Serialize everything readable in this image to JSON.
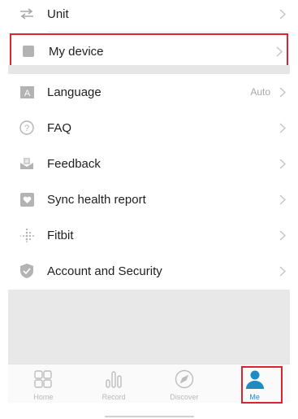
{
  "settings": {
    "unit": {
      "label": "Unit",
      "icon": "swap-arrows-icon"
    },
    "my_device": {
      "label": "My device",
      "icon": "device-icon"
    },
    "language": {
      "label": "Language",
      "value": "Auto",
      "icon": "language-icon"
    },
    "faq": {
      "label": "FAQ",
      "icon": "question-icon"
    },
    "feedback": {
      "label": "Feedback",
      "icon": "feedback-icon"
    },
    "sync": {
      "label": "Sync health report",
      "icon": "heart-icon"
    },
    "fitbit": {
      "label": "Fitbit",
      "icon": "fitbit-icon"
    },
    "account": {
      "label": "Account and Security",
      "icon": "shield-icon"
    }
  },
  "tabs": [
    {
      "label": "Home",
      "icon": "grid-icon",
      "active": false
    },
    {
      "label": "Record",
      "icon": "bars-icon",
      "active": false
    },
    {
      "label": "Discover",
      "icon": "compass-icon",
      "active": false
    },
    {
      "label": "Me",
      "icon": "person-icon",
      "active": true
    }
  ],
  "colors": {
    "accent": "#1e8bc3",
    "highlight": "#d8262e",
    "icon_gray": "#bdbdbd"
  }
}
